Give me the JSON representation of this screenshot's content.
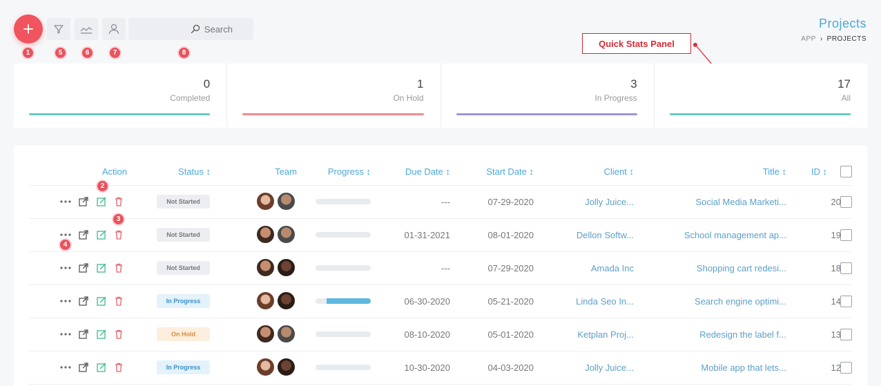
{
  "toolbar": {
    "search_placeholder": "Search",
    "badges": [
      "1",
      "5",
      "6",
      "7",
      "8"
    ]
  },
  "page": {
    "title": "Projects",
    "breadcrumb_app": "APP",
    "breadcrumb_current": "PROJECTS"
  },
  "callout": "Quick Stats Panel",
  "stats": [
    {
      "value": "0",
      "label": "Completed",
      "color": "#6cc7c0"
    },
    {
      "value": "1",
      "label": "On Hold",
      "color": "#ee8a8f"
    },
    {
      "value": "3",
      "label": "In Progress",
      "color": "#9c95d6"
    },
    {
      "value": "17",
      "label": "All",
      "color": "#6cc7c0"
    }
  ],
  "table": {
    "headers": {
      "action": "Action",
      "status": "Status ↕",
      "team": "Team",
      "progress": "Progress ↕",
      "due": "Due Date ↕",
      "start": "Start Date ↕",
      "client": "Client ↕",
      "title": "Title ↕",
      "id": "ID ↕"
    },
    "row_badges": [
      "2",
      "3",
      "4"
    ],
    "rows": [
      {
        "id": "20",
        "title": "Social Media Marketi...",
        "client": "Jolly Juice...",
        "start": "07-29-2020",
        "due": "---",
        "progress": 0,
        "status": "Not Started",
        "status_type": "ns"
      },
      {
        "id": "19",
        "title": "School management ap...",
        "client": "Dellon Softw...",
        "start": "08-01-2020",
        "due": "01-31-2021",
        "progress": 0,
        "status": "Not Started",
        "status_type": "ns"
      },
      {
        "id": "18",
        "title": "Shopping cart redesi...",
        "client": "Amada Inc",
        "start": "07-29-2020",
        "due": "---",
        "progress": 0,
        "status": "Not Started",
        "status_type": "ns"
      },
      {
        "id": "14",
        "title": "Search engine optimi...",
        "client": "Linda Seo In...",
        "start": "05-21-2020",
        "due": "06-30-2020",
        "progress": 0.8,
        "status": "In Progress",
        "status_type": "ip"
      },
      {
        "id": "13",
        "title": "Redesign the label f...",
        "client": "Ketplan Proj...",
        "start": "05-01-2020",
        "due": "08-10-2020",
        "progress": 0,
        "status": "On Hold",
        "status_type": "oh"
      },
      {
        "id": "12",
        "title": "Mobile app that lets...",
        "client": "Jolly Juice...",
        "start": "04-03-2020",
        "due": "10-30-2020",
        "progress": 0,
        "status": "In Progress",
        "status_type": "ip"
      }
    ]
  }
}
